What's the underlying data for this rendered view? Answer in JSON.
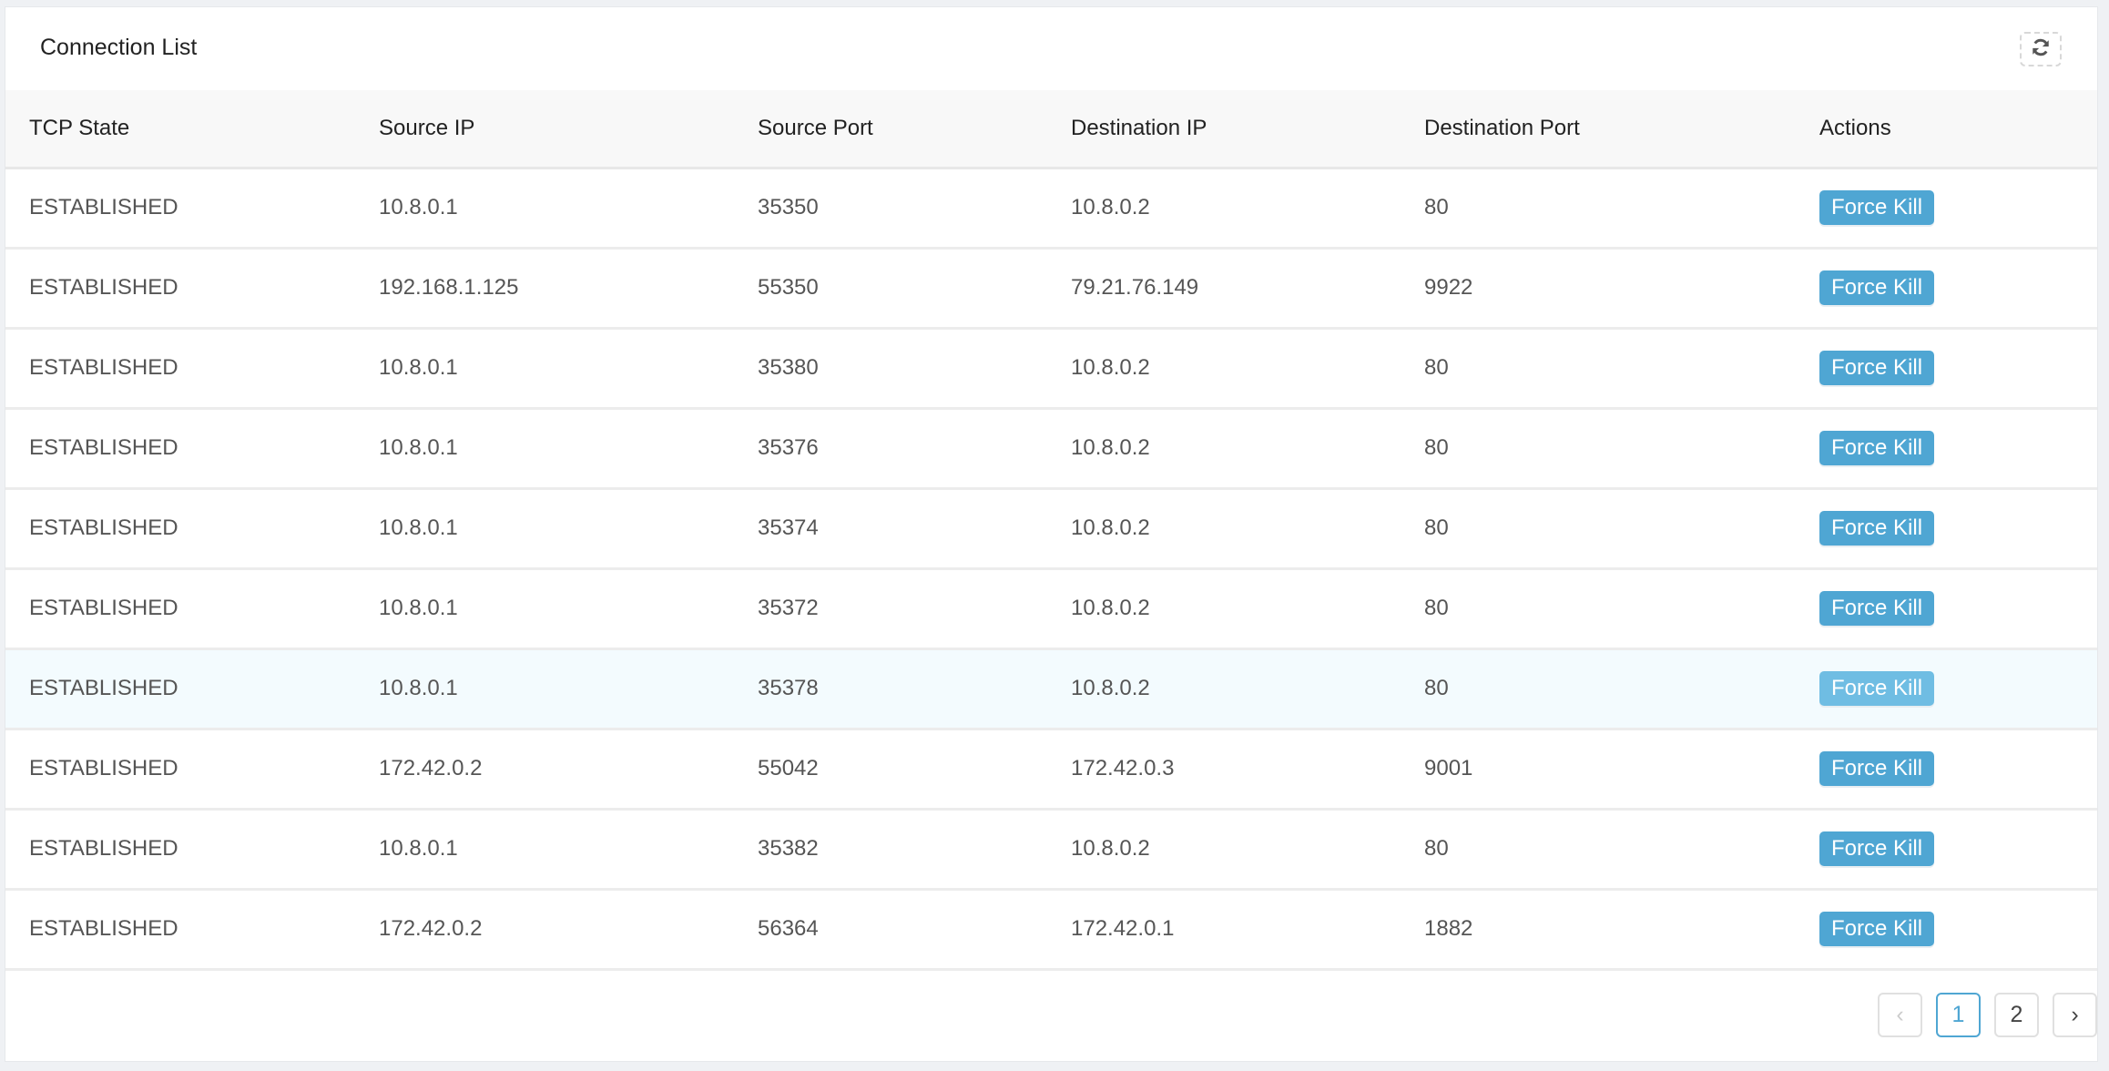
{
  "panel": {
    "title": "Connection List",
    "refresh_icon": "refresh-icon"
  },
  "table": {
    "columns": [
      "TCP State",
      "Source IP",
      "Source Port",
      "Destination IP",
      "Destination Port",
      "Actions"
    ],
    "rows": [
      {
        "state": "ESTABLISHED",
        "src_ip": "10.8.0.1",
        "src_port": "35350",
        "dst_ip": "10.8.0.2",
        "dst_port": "80",
        "action": "Force Kill"
      },
      {
        "state": "ESTABLISHED",
        "src_ip": "192.168.1.125",
        "src_port": "55350",
        "dst_ip": "79.21.76.149",
        "dst_port": "9922",
        "action": "Force Kill"
      },
      {
        "state": "ESTABLISHED",
        "src_ip": "10.8.0.1",
        "src_port": "35380",
        "dst_ip": "10.8.0.2",
        "dst_port": "80",
        "action": "Force Kill"
      },
      {
        "state": "ESTABLISHED",
        "src_ip": "10.8.0.1",
        "src_port": "35376",
        "dst_ip": "10.8.0.2",
        "dst_port": "80",
        "action": "Force Kill"
      },
      {
        "state": "ESTABLISHED",
        "src_ip": "10.8.0.1",
        "src_port": "35374",
        "dst_ip": "10.8.0.2",
        "dst_port": "80",
        "action": "Force Kill"
      },
      {
        "state": "ESTABLISHED",
        "src_ip": "10.8.0.1",
        "src_port": "35372",
        "dst_ip": "10.8.0.2",
        "dst_port": "80",
        "action": "Force Kill"
      },
      {
        "state": "ESTABLISHED",
        "src_ip": "10.8.0.1",
        "src_port": "35378",
        "dst_ip": "10.8.0.2",
        "dst_port": "80",
        "action": "Force Kill",
        "hovered": true
      },
      {
        "state": "ESTABLISHED",
        "src_ip": "172.42.0.2",
        "src_port": "55042",
        "dst_ip": "172.42.0.3",
        "dst_port": "9001",
        "action": "Force Kill"
      },
      {
        "state": "ESTABLISHED",
        "src_ip": "10.8.0.1",
        "src_port": "35382",
        "dst_ip": "10.8.0.2",
        "dst_port": "80",
        "action": "Force Kill"
      },
      {
        "state": "ESTABLISHED",
        "src_ip": "172.42.0.2",
        "src_port": "56364",
        "dst_ip": "172.42.0.1",
        "dst_port": "1882",
        "action": "Force Kill"
      }
    ]
  },
  "pagination": {
    "prev": "‹",
    "pages": [
      "1",
      "2"
    ],
    "current": "1",
    "next": "›"
  },
  "colors": {
    "accent": "#4fa6d3",
    "hover_row": "#f3fbfe",
    "header_bg": "#f8f8f8"
  }
}
